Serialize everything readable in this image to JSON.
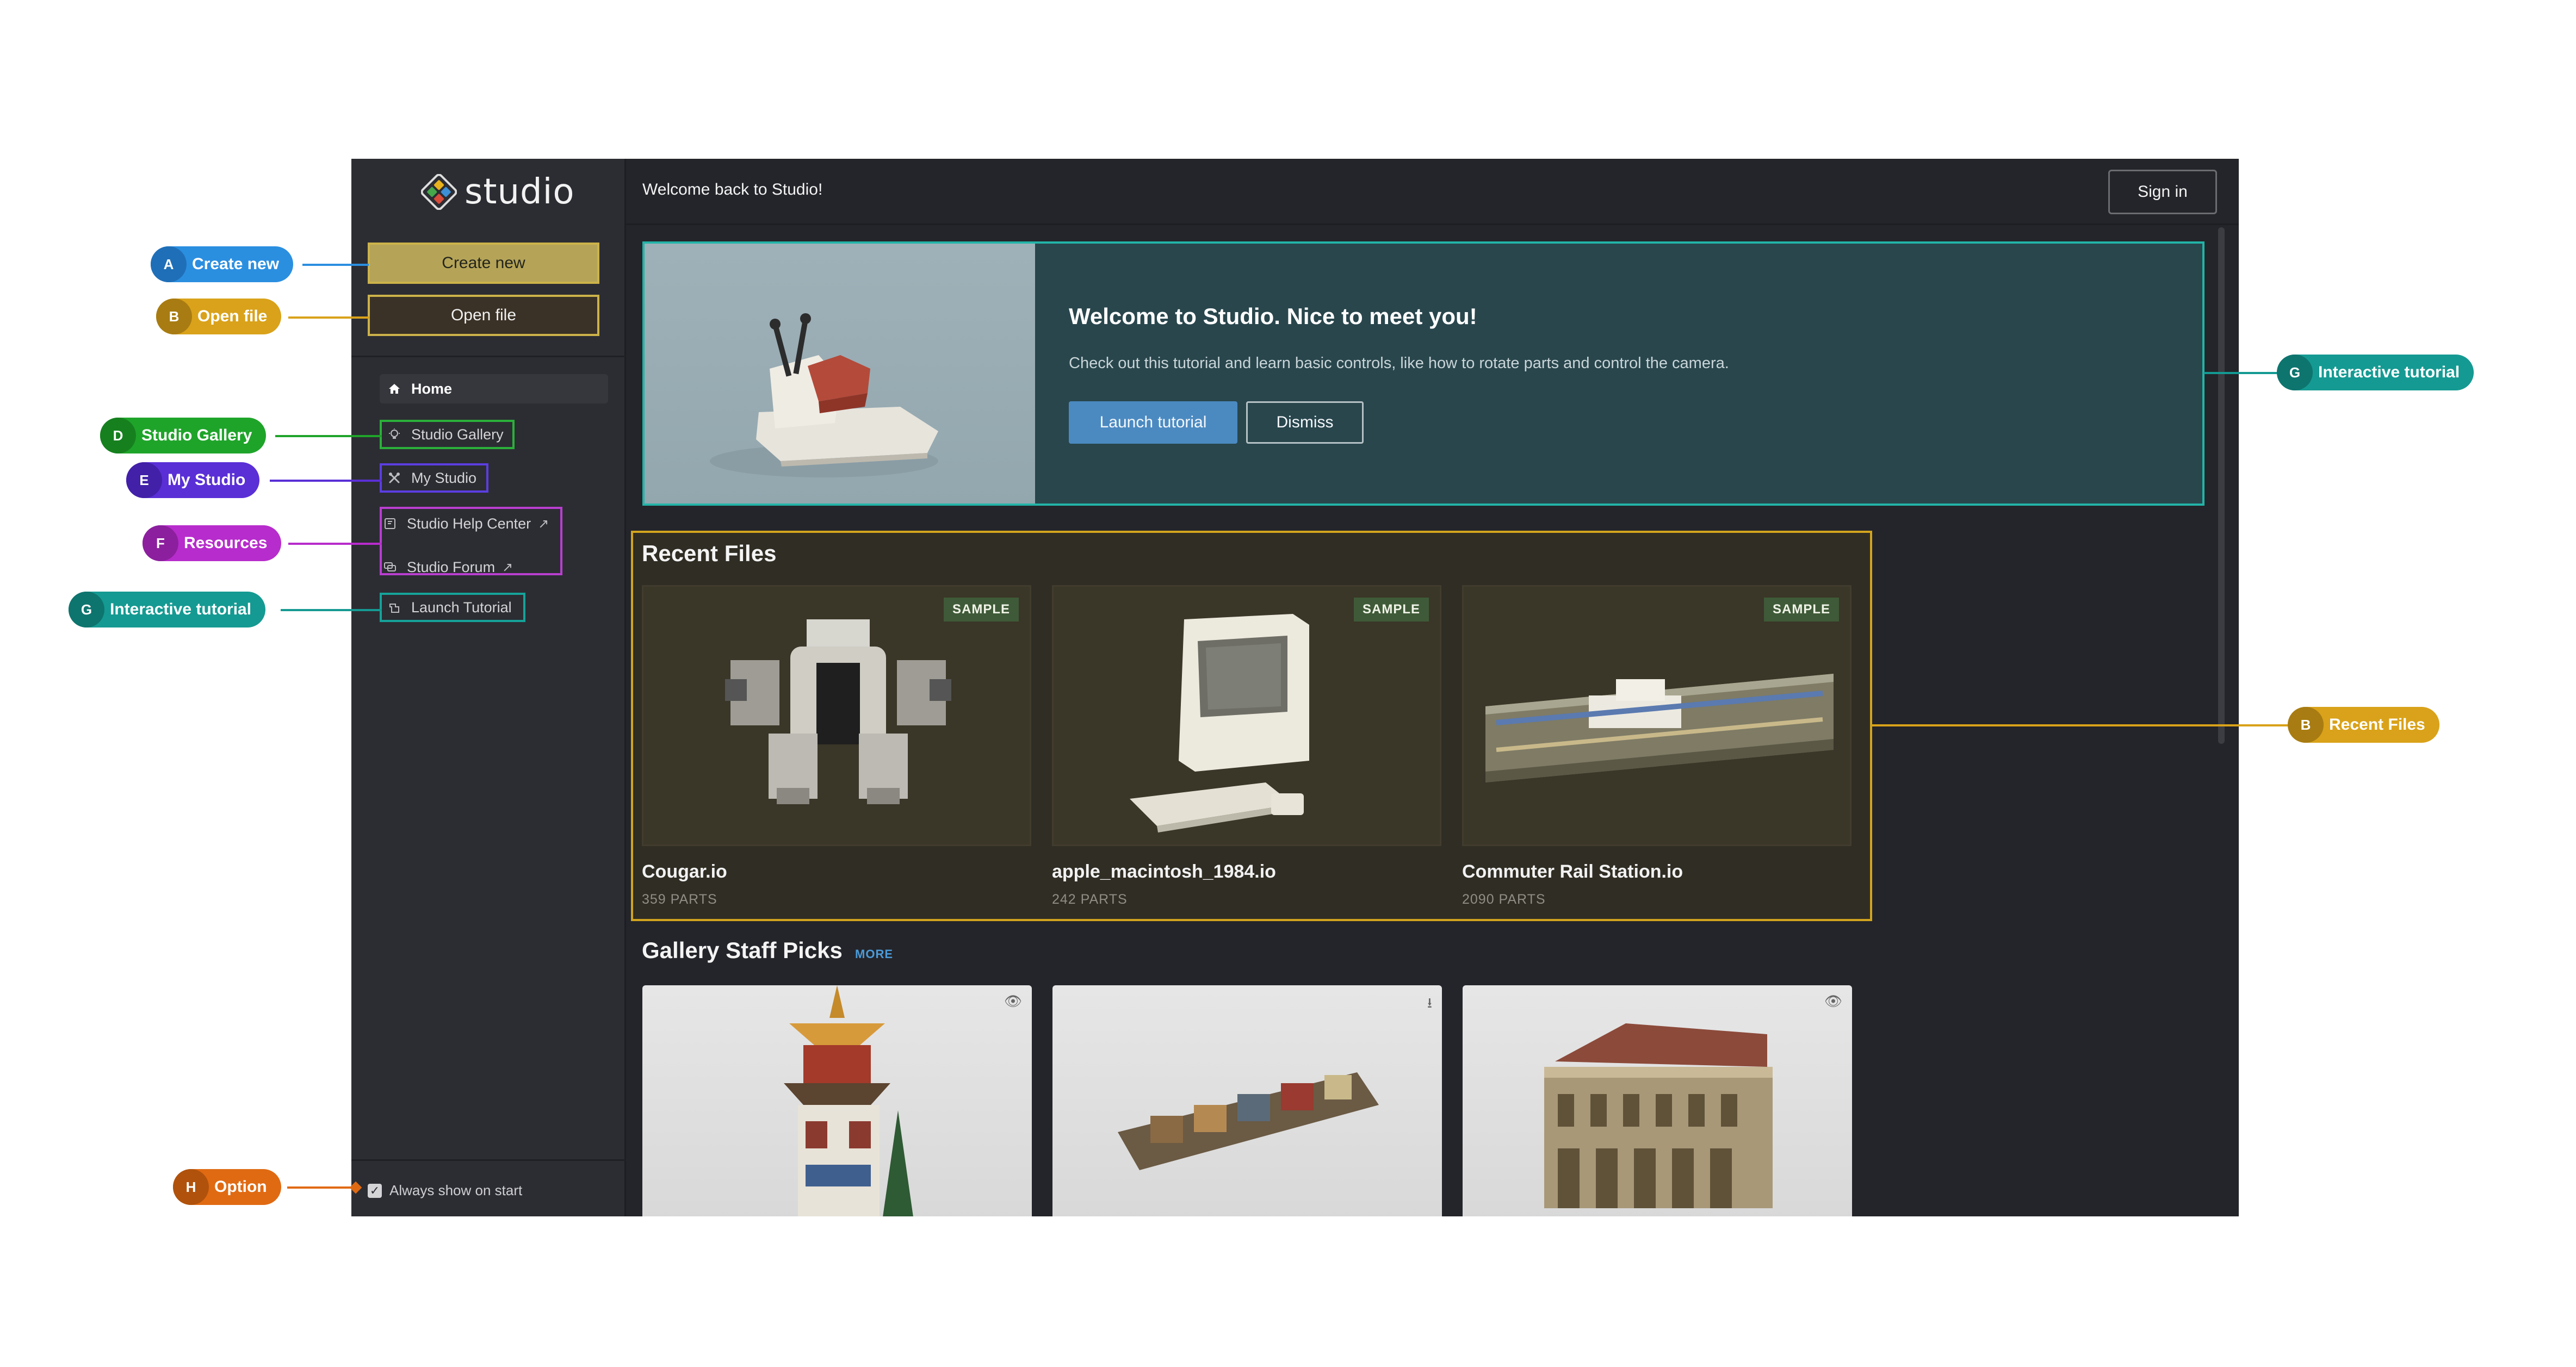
{
  "app": {
    "logo_text": "studio",
    "topbar_title": "Welcome back to Studio!",
    "sign_in_label": "Sign in"
  },
  "sidebar": {
    "create_new": "Create new",
    "open_file": "Open file",
    "nav": {
      "home": "Home",
      "gallery": "Studio Gallery",
      "my_studio": "My Studio",
      "help_center": "Studio Help Center",
      "forum": "Studio Forum",
      "launch_tutorial": "Launch Tutorial"
    },
    "option_label": "Always show on start"
  },
  "tutorial": {
    "title": "Welcome to Studio. Nice to meet you!",
    "subtitle": "Check out this tutorial and learn basic controls, like how to rotate parts and control the camera.",
    "launch_label": "Launch tutorial",
    "dismiss_label": "Dismiss"
  },
  "recent_files": {
    "title": "Recent Files",
    "badge": "SAMPLE",
    "files": [
      {
        "name": "Cougar.io",
        "parts": "359 PARTS"
      },
      {
        "name": "apple_macintosh_1984.io",
        "parts": "242 PARTS"
      },
      {
        "name": "Commuter Rail Station.io",
        "parts": "2090 PARTS"
      }
    ]
  },
  "gallery": {
    "title": "Gallery Staff Picks",
    "more": "MORE",
    "cards": [
      {
        "icon": "eye-icon"
      },
      {
        "icon": "download-icon"
      },
      {
        "icon": "eye-icon"
      }
    ]
  },
  "annotations": {
    "a": {
      "letter": "A",
      "label": "Create new",
      "color": "#2b8fe0"
    },
    "b_open": {
      "letter": "B",
      "label": "Open file",
      "color": "#d9a21a"
    },
    "d": {
      "letter": "D",
      "label": "Studio Gallery",
      "color": "#1fa42a"
    },
    "e": {
      "letter": "E",
      "label": "My Studio",
      "color": "#5a2fd6"
    },
    "f": {
      "letter": "F",
      "label": "Resources",
      "color": "#b72ccc"
    },
    "g_left": {
      "letter": "G",
      "label": "Interactive tutorial",
      "color": "#149a92"
    },
    "h": {
      "letter": "H",
      "label": "Option",
      "color": "#e06a12"
    },
    "g_right": {
      "letter": "G",
      "label": "Interactive tutorial",
      "color": "#149a92"
    },
    "b_recent": {
      "letter": "B",
      "label": "Recent Files",
      "color": "#d9a21a"
    }
  }
}
